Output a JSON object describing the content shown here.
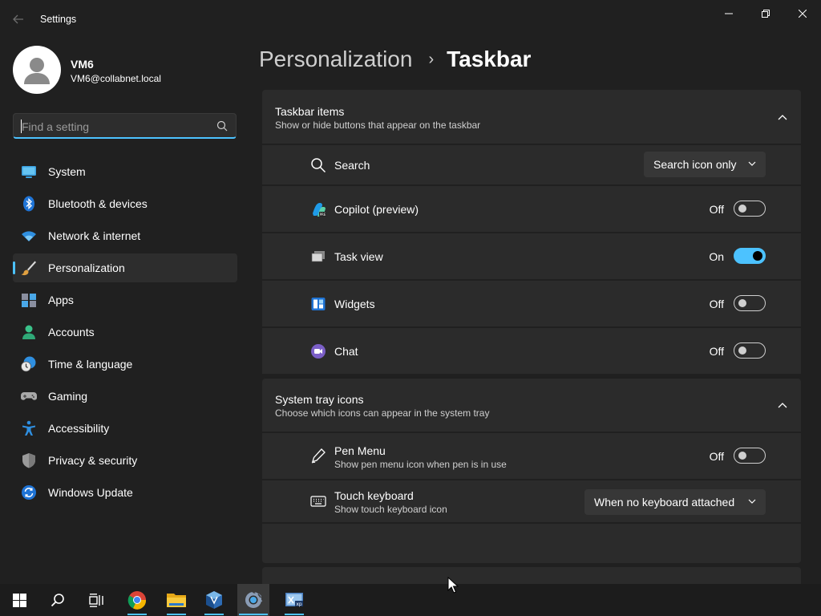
{
  "window": {
    "title": "Settings",
    "controls": {
      "minimize": "minimize-icon",
      "maximize": "restore-icon",
      "close": "close-icon"
    }
  },
  "profile": {
    "name": "VM6",
    "email": "VM6@collabnet.local"
  },
  "search": {
    "placeholder": "Find a setting"
  },
  "sidebar": {
    "items": [
      {
        "label": "System",
        "icon": "monitor-icon"
      },
      {
        "label": "Bluetooth & devices",
        "icon": "bluetooth-icon"
      },
      {
        "label": "Network & internet",
        "icon": "wifi-icon"
      },
      {
        "label": "Personalization",
        "icon": "paintbrush-icon",
        "active": true
      },
      {
        "label": "Apps",
        "icon": "apps-icon"
      },
      {
        "label": "Accounts",
        "icon": "person-icon"
      },
      {
        "label": "Time & language",
        "icon": "clock-globe-icon"
      },
      {
        "label": "Gaming",
        "icon": "gamepad-icon"
      },
      {
        "label": "Accessibility",
        "icon": "accessibility-icon"
      },
      {
        "label": "Privacy & security",
        "icon": "shield-icon"
      },
      {
        "label": "Windows Update",
        "icon": "update-icon"
      }
    ]
  },
  "header": {
    "parent": "Personalization",
    "separator": "›",
    "current": "Taskbar"
  },
  "taskbar_items": {
    "title": "Taskbar items",
    "subtitle": "Show or hide buttons that appear on the taskbar",
    "rows": [
      {
        "label": "Search",
        "icon": "search-icon",
        "control": "dropdown",
        "value": "Search icon only"
      },
      {
        "label": "Copilot (preview)",
        "icon": "copilot-icon",
        "control": "toggle",
        "state": "Off",
        "on": false
      },
      {
        "label": "Task view",
        "icon": "task-view-icon",
        "control": "toggle",
        "state": "On",
        "on": true
      },
      {
        "label": "Widgets",
        "icon": "widgets-icon",
        "control": "toggle",
        "state": "Off",
        "on": false
      },
      {
        "label": "Chat",
        "icon": "chat-icon",
        "control": "toggle",
        "state": "Off",
        "on": false
      }
    ]
  },
  "system_tray": {
    "title": "System tray icons",
    "subtitle": "Choose which icons can appear in the system tray",
    "rows": [
      {
        "label": "Pen Menu",
        "sub": "Show pen menu icon when pen is in use",
        "icon": "pen-icon",
        "control": "toggle",
        "state": "Off",
        "on": false
      },
      {
        "label": "Touch keyboard",
        "sub": "Show touch keyboard icon",
        "icon": "keyboard-icon",
        "control": "dropdown",
        "value": "When no keyboard attached"
      }
    ]
  },
  "taskbar": {
    "buttons": [
      {
        "name": "start-icon"
      },
      {
        "name": "taskbar-search-icon"
      },
      {
        "name": "taskbar-task-view-icon"
      },
      {
        "name": "chrome-icon",
        "running": true
      },
      {
        "name": "file-explorer-icon",
        "running": true
      },
      {
        "name": "virtualbox-icon",
        "running": true
      },
      {
        "name": "settings-icon",
        "active": true
      },
      {
        "name": "windows-xp-mode-icon",
        "running": true
      }
    ]
  },
  "colors": {
    "accent": "#4cc2ff",
    "background": "#202020",
    "card": "#2b2b2b"
  }
}
